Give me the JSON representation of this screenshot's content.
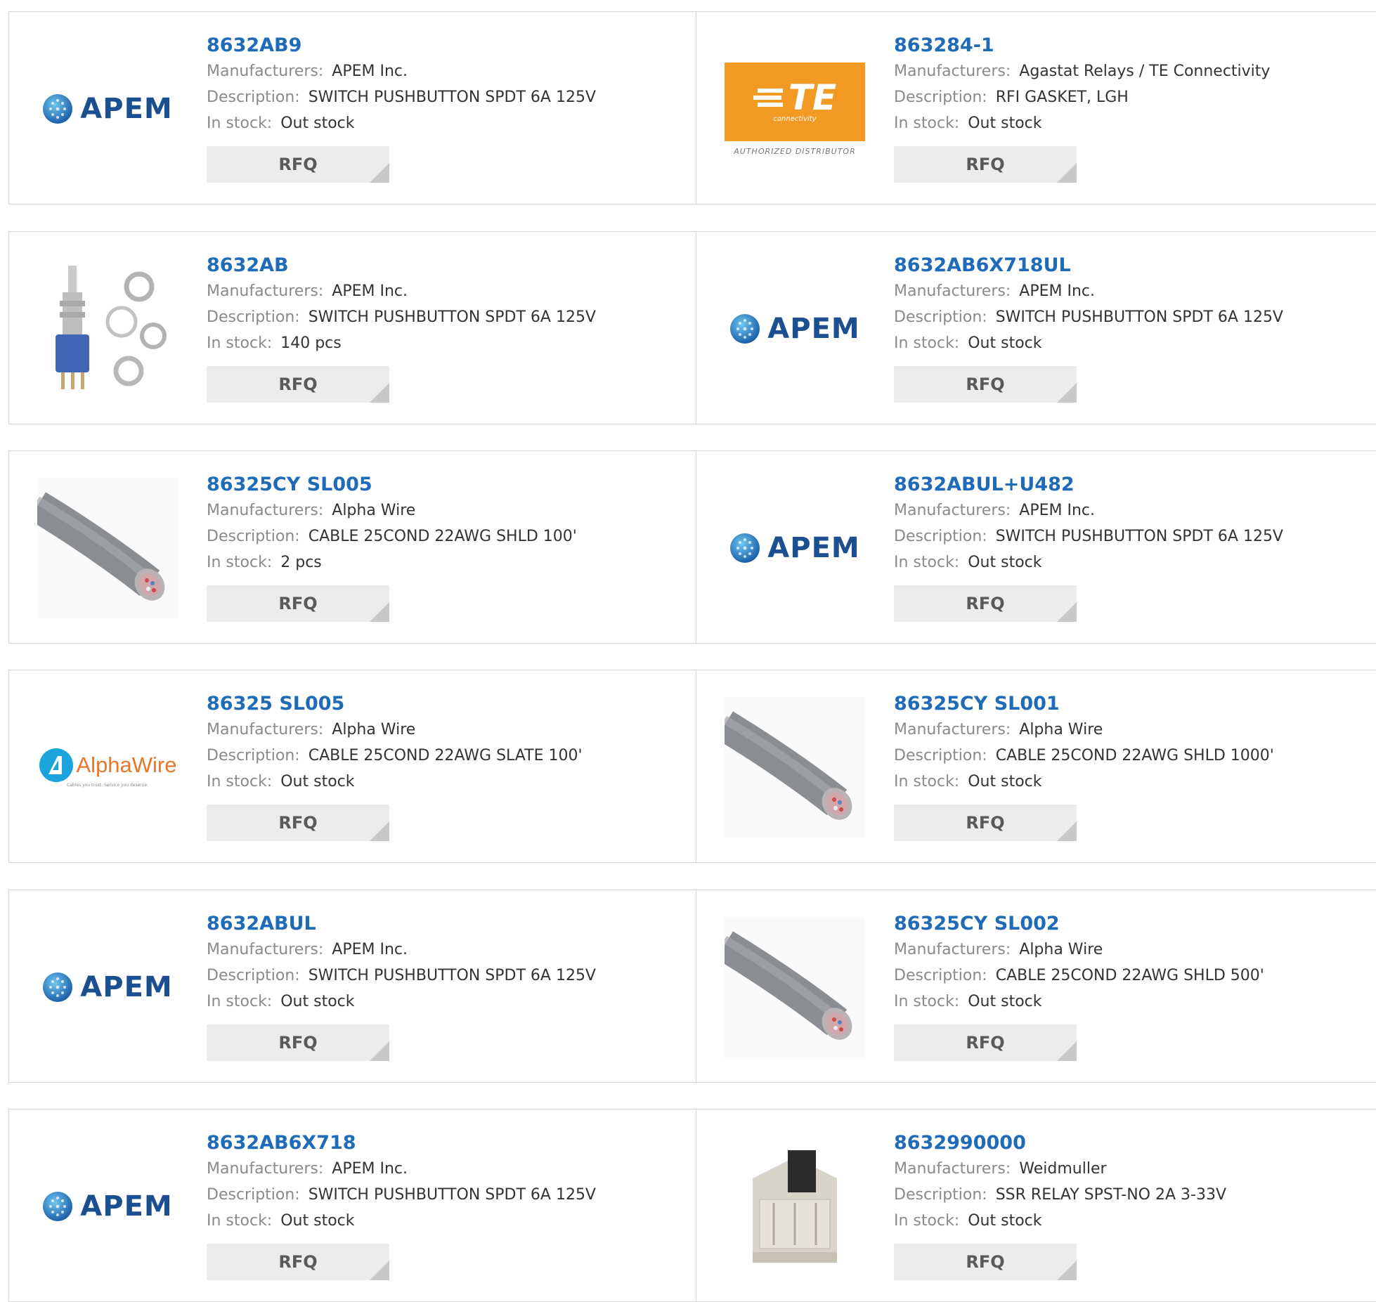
{
  "labels": {
    "manufacturers": "Manufacturers:",
    "description": "Description:",
    "in_stock": "In stock:",
    "rfq": "RFQ"
  },
  "logos": {
    "apem": "APEM",
    "te": "TE",
    "te_sub": "connectivity",
    "te_authorized": "AUTHORIZED DISTRIBUTOR",
    "alpha": "AlphaWire",
    "alpha_tagline": "Cables you trust. Service you deserve."
  },
  "colors": {
    "part_link": "#1f6bb8",
    "apem_blue": "#1b4f8f",
    "te_orange": "#f39a24",
    "alpha_orange": "#e8762b",
    "rfq_bg": "#ececec"
  },
  "products": [
    {
      "part": "8632AB9",
      "manufacturer": "APEM Inc.",
      "description": "SWITCH PUSHBUTTON SPDT 6A 125V",
      "stock": "Out stock",
      "image": "apem-logo"
    },
    {
      "part": "863284-1",
      "manufacturer": "Agastat Relays / TE Connectivity",
      "description": "RFI GASKET, LGH",
      "stock": "Out stock",
      "image": "te-logo"
    },
    {
      "part": "8632AB",
      "manufacturer": "APEM Inc.",
      "description": "SWITCH PUSHBUTTON SPDT 6A 125V",
      "stock": "140 pcs",
      "image": "pushbutton-switch-photo"
    },
    {
      "part": "8632AB6X718UL",
      "manufacturer": "APEM Inc.",
      "description": "SWITCH PUSHBUTTON SPDT 6A 125V",
      "stock": "Out stock",
      "image": "apem-logo"
    },
    {
      "part": "86325CY SL005",
      "manufacturer": "Alpha Wire",
      "description": "CABLE 25COND 22AWG SHLD 100'",
      "stock": "2 pcs",
      "image": "cable-photo"
    },
    {
      "part": "8632ABUL+U482",
      "manufacturer": "APEM Inc.",
      "description": "SWITCH PUSHBUTTON SPDT 6A 125V",
      "stock": "Out stock",
      "image": "apem-logo"
    },
    {
      "part": "86325 SL005",
      "manufacturer": "Alpha Wire",
      "description": "CABLE 25COND 22AWG SLATE 100'",
      "stock": "Out stock",
      "image": "alphawire-logo"
    },
    {
      "part": "86325CY SL001",
      "manufacturer": "Alpha Wire",
      "description": "CABLE 25COND 22AWG SHLD 1000'",
      "stock": "Out stock",
      "image": "cable-photo"
    },
    {
      "part": "8632ABUL",
      "manufacturer": "APEM Inc.",
      "description": "SWITCH PUSHBUTTON SPDT 6A 125V",
      "stock": "Out stock",
      "image": "apem-logo"
    },
    {
      "part": "86325CY SL002",
      "manufacturer": "Alpha Wire",
      "description": "CABLE 25COND 22AWG SHLD 500'",
      "stock": "Out stock",
      "image": "cable-photo"
    },
    {
      "part": "8632AB6X718",
      "manufacturer": "APEM Inc.",
      "description": "SWITCH PUSHBUTTON SPDT 6A 125V",
      "stock": "Out stock",
      "image": "apem-logo"
    },
    {
      "part": "8632990000",
      "manufacturer": "Weidmuller",
      "description": "SSR RELAY SPST-NO 2A 3-33V",
      "stock": "Out stock",
      "image": "relay-photo"
    }
  ]
}
